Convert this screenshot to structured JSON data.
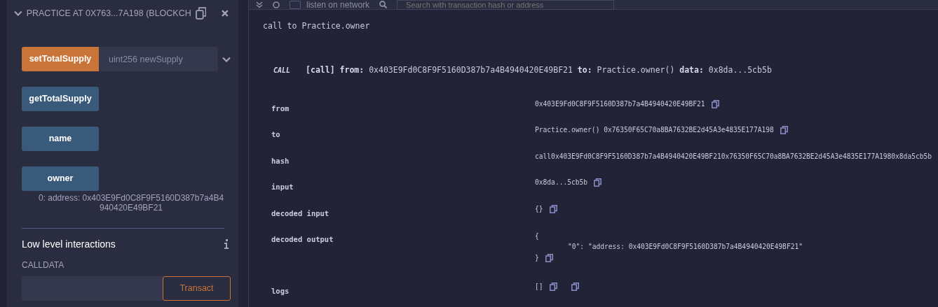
{
  "panel": {
    "title": "PRACTICE AT 0X763...7A198 (BLOCKCH",
    "expanded": true
  },
  "functions": [
    {
      "label": "setTotalSupply",
      "kind": "transact",
      "placeholder": "uint256 newSupply"
    },
    {
      "label": "getTotalSupply",
      "kind": "call"
    },
    {
      "label": "name",
      "kind": "call"
    },
    {
      "label": "owner",
      "kind": "call",
      "result": "0:  address: 0x403E9Fd0C8F9F5160D387b7a4B4940420E49BF21"
    }
  ],
  "low_level": {
    "title": "Low level interactions",
    "calldata_label": "CALLDATA",
    "button": "Transact"
  },
  "terminal": {
    "listen_label": "listen on network",
    "listen_checked": false,
    "search_placeholder": "Search with transaction hash or address",
    "message": "call to Practice.owner",
    "badge": "CALL",
    "summary": "**[call]** **from:** 0x403E9Fd0C8F9F5160D387b7a4B4940420E49BF21 **to:** Practice.owner() **data:** 0x8da...5cb5b",
    "details": [
      {
        "label": "from",
        "kind": "copy",
        "value": "0x403E9Fd0C8F9F5160D387b7a4B4940420E49BF21"
      },
      {
        "label": "to",
        "kind": "copy",
        "value": "Practice.owner() 0x76350F65C70a8BA7632BE2d45A3e4835E177A198"
      },
      {
        "label": "hash",
        "kind": "plain",
        "value": "call0x403E9Fd0C8F9F5160D387b7a4B4940420E49BF210x76350F65C70a8BA7632BE2d45A3e4835E177A1980x8da5cb5b"
      },
      {
        "label": "input",
        "kind": "copy",
        "value": "0x8da...5cb5b"
      },
      {
        "label": "decoded input",
        "kind": "copy",
        "value": "{}"
      },
      {
        "label": "decoded output",
        "kind": "json",
        "lines": [
          "{",
          "\"0\": \"address: 0x403E9Fd0C8F9F5160D387b7a4B4940420E49BF21\"",
          "}"
        ]
      },
      {
        "label": "logs",
        "kind": "double-copy",
        "value": "[]"
      }
    ]
  }
}
